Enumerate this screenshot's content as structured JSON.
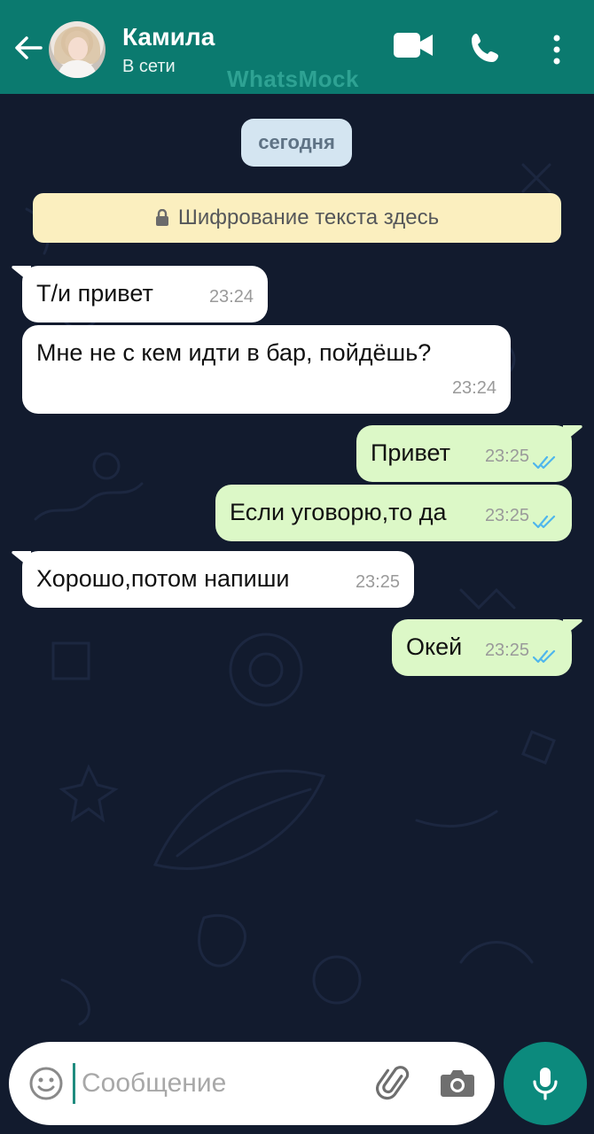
{
  "header": {
    "contact_name": "Камила",
    "status": "В сети",
    "watermark": "WhatsMock"
  },
  "chat": {
    "date_label": "сегодня",
    "encryption_notice": "Шифрование текста здесь",
    "messages": [
      {
        "direction": "incoming",
        "text": "Т/и привет",
        "time": "23:24"
      },
      {
        "direction": "incoming",
        "text": "Мне не с кем идти в бар, пойдёшь?",
        "time": "23:24"
      },
      {
        "direction": "outgoing",
        "text": "Привет",
        "time": "23:25",
        "status": "read"
      },
      {
        "direction": "outgoing",
        "text": "Если уговорю,то да",
        "time": "23:25",
        "status": "read"
      },
      {
        "direction": "incoming",
        "text": "Хорошо,потом напиши",
        "time": "23:25"
      },
      {
        "direction": "outgoing",
        "text": "Окей",
        "time": "23:25",
        "status": "read"
      }
    ]
  },
  "composer": {
    "placeholder": "Сообщение",
    "value": ""
  },
  "icons": {
    "back": "arrow-left-icon",
    "video": "video-camera-icon",
    "call": "phone-icon",
    "menu": "more-vertical-icon",
    "emoji": "emoji-icon",
    "attach": "paperclip-icon",
    "camera": "camera-icon",
    "mic": "microphone-icon",
    "read_status": "double-check-icon"
  },
  "colors": {
    "header": "#0b7a6f",
    "chat_background": "#121b2e",
    "incoming_bubble": "#ffffff",
    "outgoing_bubble": "#dcf8c7",
    "read_ticks": "#4fb6ec",
    "mic_button": "#0c8a7d"
  }
}
